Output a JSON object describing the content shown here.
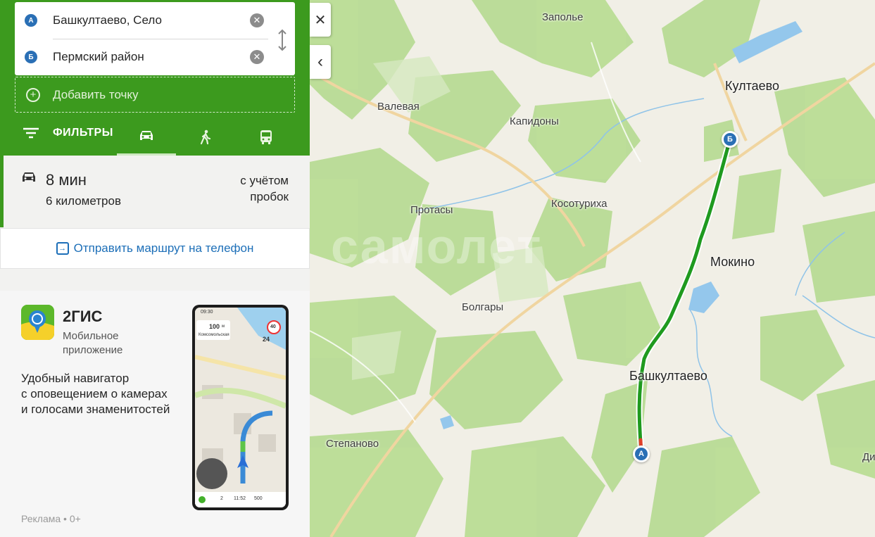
{
  "route_panel": {
    "from": {
      "marker": "А",
      "value": "Башкултаево, Село"
    },
    "to": {
      "marker": "Б",
      "value": "Пермский район"
    },
    "add_point_label": "Добавить точку",
    "filters_label": "ФИЛЬТРЫ",
    "modes": [
      {
        "name": "car",
        "icon": "car-icon",
        "active": true
      },
      {
        "name": "walk",
        "icon": "pedestrian-icon",
        "active": false
      },
      {
        "name": "transit",
        "icon": "bus-icon",
        "active": false
      }
    ]
  },
  "route_result": {
    "time": "8 мин",
    "distance": "6 километров",
    "traffic_line1": "с учётом",
    "traffic_line2": "пробок",
    "send_to_phone": "Отправить маршрут на телефон"
  },
  "ad": {
    "app_name": "2ГИС",
    "app_subtitle_line1": "Мобильное",
    "app_subtitle_line2": "приложение",
    "desc_line1": "Удобный навигатор",
    "desc_line2": "с оповещением о камерах",
    "desc_line3": "и голосами знаменитостей",
    "label": "Реклама • 0+",
    "phone": {
      "clock": "09:30",
      "distance": "100",
      "distance_unit": "м",
      "street": "Комсомольская",
      "speed_limit": "40",
      "speed": "24",
      "bottom": [
        "2",
        "11:52",
        "500"
      ]
    }
  },
  "map": {
    "places": [
      {
        "name": "Заполье"
      },
      {
        "name": "Култаево",
        "big": true
      },
      {
        "name": "Валевая"
      },
      {
        "name": "Капидоны"
      },
      {
        "name": "Протасы"
      },
      {
        "name": "Косотуриха"
      },
      {
        "name": "Мокино",
        "big": true
      },
      {
        "name": "Болгары"
      },
      {
        "name": "Башкултаево",
        "big": true
      },
      {
        "name": "Степаново"
      },
      {
        "name": "Ди"
      }
    ],
    "start_marker": "А",
    "end_marker": "Б",
    "close_button": "✕",
    "collapse_button": "‹",
    "colors": {
      "route": "#1f9a1f",
      "route_start": "#e0402a",
      "forest": "#b5d98f",
      "water": "#8fc3e8",
      "road": "#f3d9a8"
    }
  }
}
